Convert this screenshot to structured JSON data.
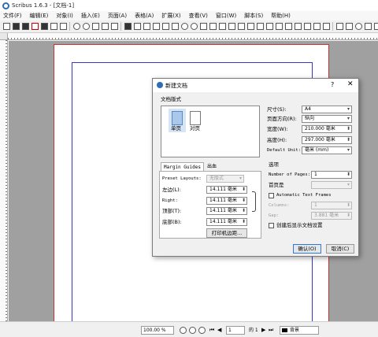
{
  "window": {
    "title": "Scribus 1.6.3 - [文档-1]"
  },
  "menu": [
    "文件(F)",
    "编辑(E)",
    "对象(I)",
    "插入(E)",
    "页面(A)",
    "表格(A)",
    "扩展(X)",
    "查看(V)",
    "窗口(W)",
    "脚本(S)",
    "帮助(H)"
  ],
  "statusbar": {
    "zoom": "100.00 %",
    "page_current": "1",
    "page_of": "的 1",
    "layer": "背景"
  },
  "dialog": {
    "title": "新建文档",
    "help": "?",
    "close": "✕",
    "layout_section": "文档版式",
    "layouts": [
      {
        "label": "单页",
        "selected": true
      },
      {
        "label": "对页",
        "selected": false
      }
    ],
    "size_label": "尺寸(S):",
    "size_value": "A4",
    "orientation_label": "页面方向(R):",
    "orientation_value": "纵向",
    "width_label": "宽度(W):",
    "width_value": "210.000 毫米",
    "height_label": "高度(H):",
    "height_value": "297.000 毫米",
    "unit_label": "Default Unit:",
    "unit_value": "毫米 (mm)",
    "tabs": {
      "margin": "Margin Guides",
      "bleed": "出血"
    },
    "preset_label": "Preset Layouts:",
    "preset_value": "无版式",
    "left_label": "左边(L):",
    "left_value": "14.111 毫米",
    "right_label": "Right:",
    "right_value": "14.111 毫米",
    "top_label": "顶部(T):",
    "top_value": "14.111 毫米",
    "bottom_label": "底部(B):",
    "bottom_value": "14.111 毫米",
    "printer_margins": "打印机边距...",
    "options_section": "选项",
    "pages_label": "Number of Pages:",
    "pages_value": "1",
    "first_page_label": "首页是",
    "auto_frames_label": "Automatic Text Frames",
    "columns_label": "Columns:",
    "columns_value": "1",
    "gap_label": "Gap:",
    "gap_value": "3.881 毫米",
    "show_settings_label": "创建后显示文档设置",
    "ok": "确认(O)",
    "cancel": "取消(C)"
  }
}
